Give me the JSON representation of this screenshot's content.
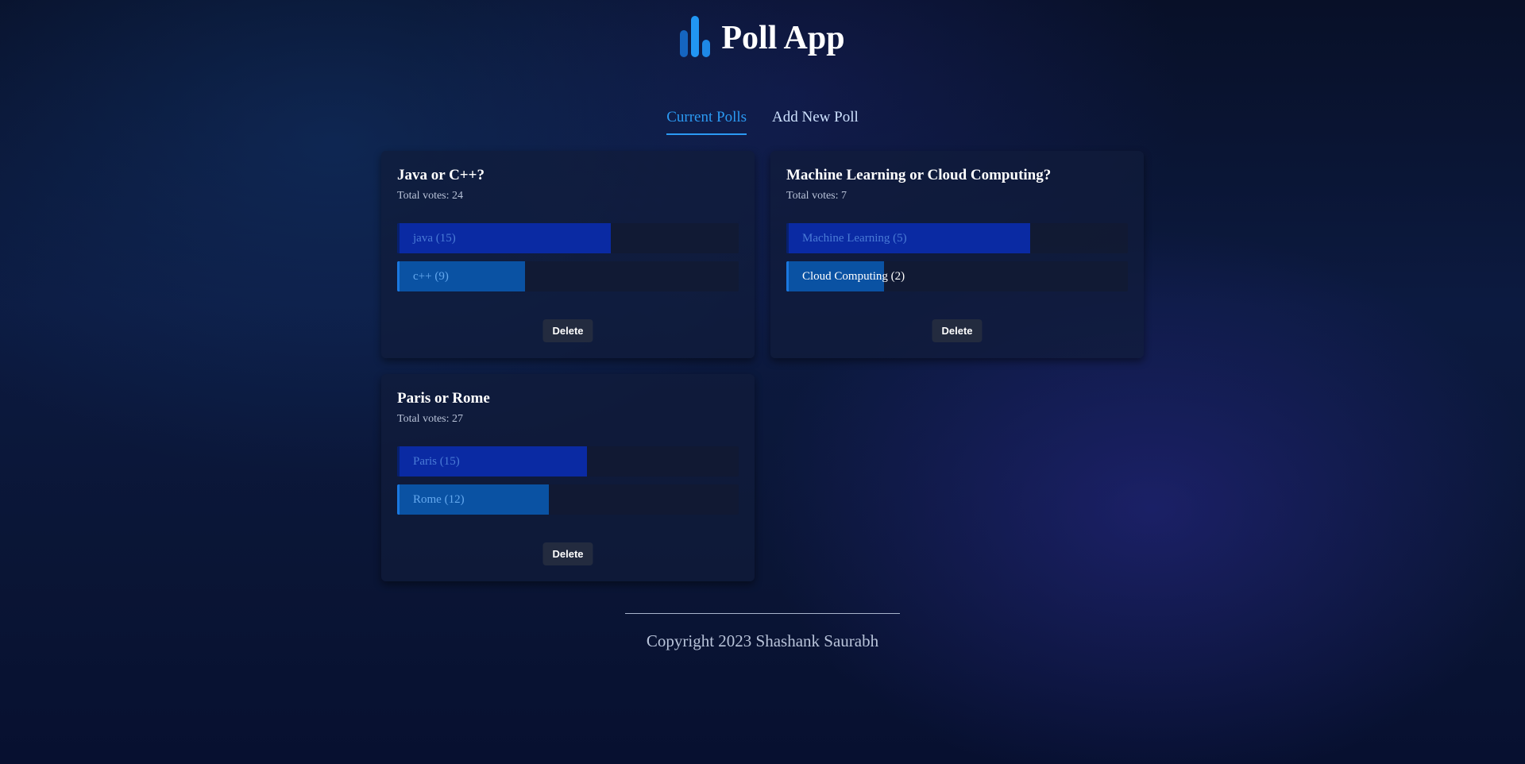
{
  "header": {
    "title": "Poll App",
    "logo_icon": "bar-chart-icon",
    "logo_colors": [
      "#1565c0",
      "#2196f3",
      "#1e88e5"
    ]
  },
  "tabs": [
    {
      "label": "Current Polls",
      "active": true
    },
    {
      "label": "Add New Poll",
      "active": false
    }
  ],
  "colors": {
    "accent": "#2b9af3",
    "option_first": "#0a2aa3",
    "option_second": "#0a52a3",
    "delete_button": "#232b3f"
  },
  "polls": [
    {
      "question": "Java or C++?",
      "total_votes_label": "Total votes: 24",
      "total_votes": 24,
      "options": [
        {
          "label": "java (15)",
          "votes": 15
        },
        {
          "label": "c++ (9)",
          "votes": 9
        }
      ],
      "delete_label": "Delete"
    },
    {
      "question": "Machine Learning or Cloud Computing?",
      "total_votes_label": "Total votes: 7",
      "total_votes": 7,
      "options": [
        {
          "label": "Machine Learning (5)",
          "votes": 5
        },
        {
          "label": "Cloud Computing (2)",
          "votes": 2
        }
      ],
      "delete_label": "Delete"
    },
    {
      "question": "Paris or Rome",
      "total_votes_label": "Total votes: 27",
      "total_votes": 27,
      "options": [
        {
          "label": "Paris (15)",
          "votes": 15
        },
        {
          "label": "Rome (12)",
          "votes": 12
        }
      ],
      "delete_label": "Delete"
    }
  ],
  "footer": {
    "copyright": "Copyright 2023 Shashank Saurabh"
  }
}
